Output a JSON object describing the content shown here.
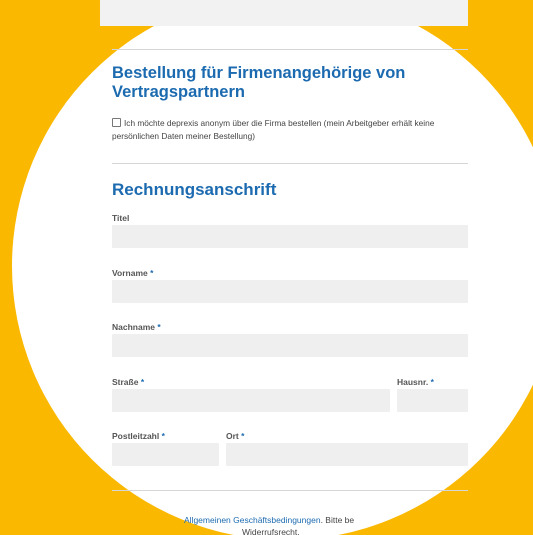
{
  "form": {
    "heading_company": "Bestellung für Firmenangehörige von Vertragspartnern",
    "anonymous_checkbox_label": "Ich möchte deprexis anonym über die Firma bestellen (mein Arbeitgeber erhält keine persönlichen Daten meiner Bestellung)",
    "billing_heading": "Rechnungsanschrift",
    "required_marker": "*",
    "fields": {
      "title_label": "Titel",
      "firstname_label": "Vorname",
      "lastname_label": "Nachname",
      "street_label": "Straße",
      "housenumber_label": "Hausnr.",
      "zip_label": "Postleitzahl",
      "city_label": "Ort"
    },
    "footer": {
      "terms_link": "Allgemeinen Geschäftsbedingungen",
      "after_link": ". Bitte be",
      "second_line": "Widerrufsrecht."
    }
  },
  "colors": {
    "background": "#FBB800",
    "accent": "#1c6bb0",
    "field_bg": "#efefef"
  }
}
